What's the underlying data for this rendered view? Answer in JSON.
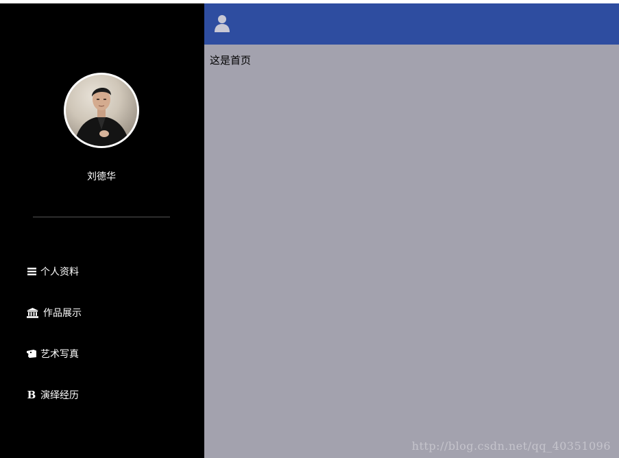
{
  "sidebar": {
    "user_name": "刘德华",
    "nav": [
      {
        "label": "个人资料",
        "icon": "menu-lines-icon"
      },
      {
        "label": "作品展示",
        "icon": "bank-icon"
      },
      {
        "label": "艺术写真",
        "icon": "ticket-icon"
      },
      {
        "label": "演绎经历",
        "icon": "bold-b-icon"
      }
    ]
  },
  "header": {
    "icon": "user-icon",
    "color": "#2e4da0"
  },
  "main": {
    "text": "这是首页",
    "background": "#a3a2ae"
  },
  "watermark": "http://blog.csdn.net/qq_40351096",
  "nav_bold_glyph": "B"
}
